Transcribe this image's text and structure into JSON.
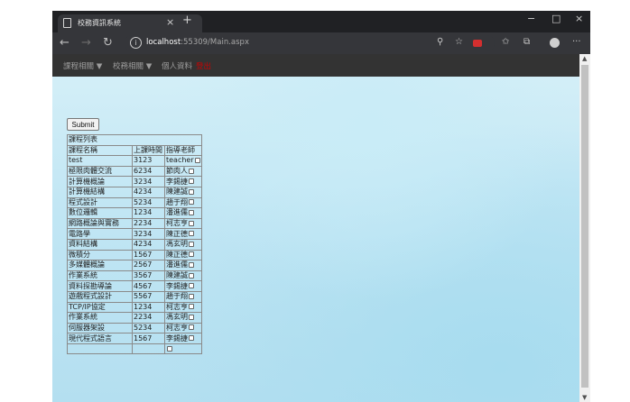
{
  "tab": {
    "title": "校務資訊系統",
    "close": "×",
    "new": "+"
  },
  "window_controls": {
    "minimize": "−",
    "maximize": "□",
    "close": "×"
  },
  "address": {
    "host": "localhost",
    "rest": ":55309/Main.aspx"
  },
  "toolbar_icons": [
    "search-icon",
    "star-icon",
    "adblock-icon",
    "favorites-icon",
    "collections-icon",
    "profile-icon",
    "more-icon"
  ],
  "nav": {
    "course": "課程相關 ▼",
    "school": "校務相關 ▼",
    "profile": "個人資料",
    "logout": "登出"
  },
  "submit_label": "Submit",
  "table": {
    "caption": "課程列表",
    "headers": [
      "課程名稱",
      "上課時間",
      "指導老師"
    ],
    "rows": [
      [
        "test",
        "3123",
        "teacher"
      ],
      [
        "極限肉體交流",
        "6234",
        "節肉人"
      ],
      [
        "計算機概論",
        "3234",
        "李錫捷"
      ],
      [
        "計算機結構",
        "4234",
        "陳建誠"
      ],
      [
        "程式設計",
        "5234",
        "趙于翔"
      ],
      [
        "數位邏輯",
        "1234",
        "潘進儒"
      ],
      [
        "網路概論與實務",
        "2234",
        "柯志亨"
      ],
      [
        "電路學",
        "3234",
        "陳正德"
      ],
      [
        "資料結構",
        "4234",
        "馮玄明"
      ],
      [
        "微積分",
        "1567",
        "陳正德"
      ],
      [
        "多媒體概論",
        "2567",
        "潘進儒"
      ],
      [
        "作業系統",
        "3567",
        "陳建誠"
      ],
      [
        "資料探勘導論",
        "4567",
        "李錫捷"
      ],
      [
        "遊戲程式設計",
        "5567",
        "趙于翔"
      ],
      [
        "TCP/IP協定",
        "1234",
        "柯志亨"
      ],
      [
        "作業系統",
        "2234",
        "馮玄明"
      ],
      [
        "伺服器架設",
        "5234",
        "柯志亨"
      ],
      [
        "現代程式語言",
        "1567",
        "李錫捷"
      ],
      [
        "",
        "",
        ""
      ]
    ]
  }
}
